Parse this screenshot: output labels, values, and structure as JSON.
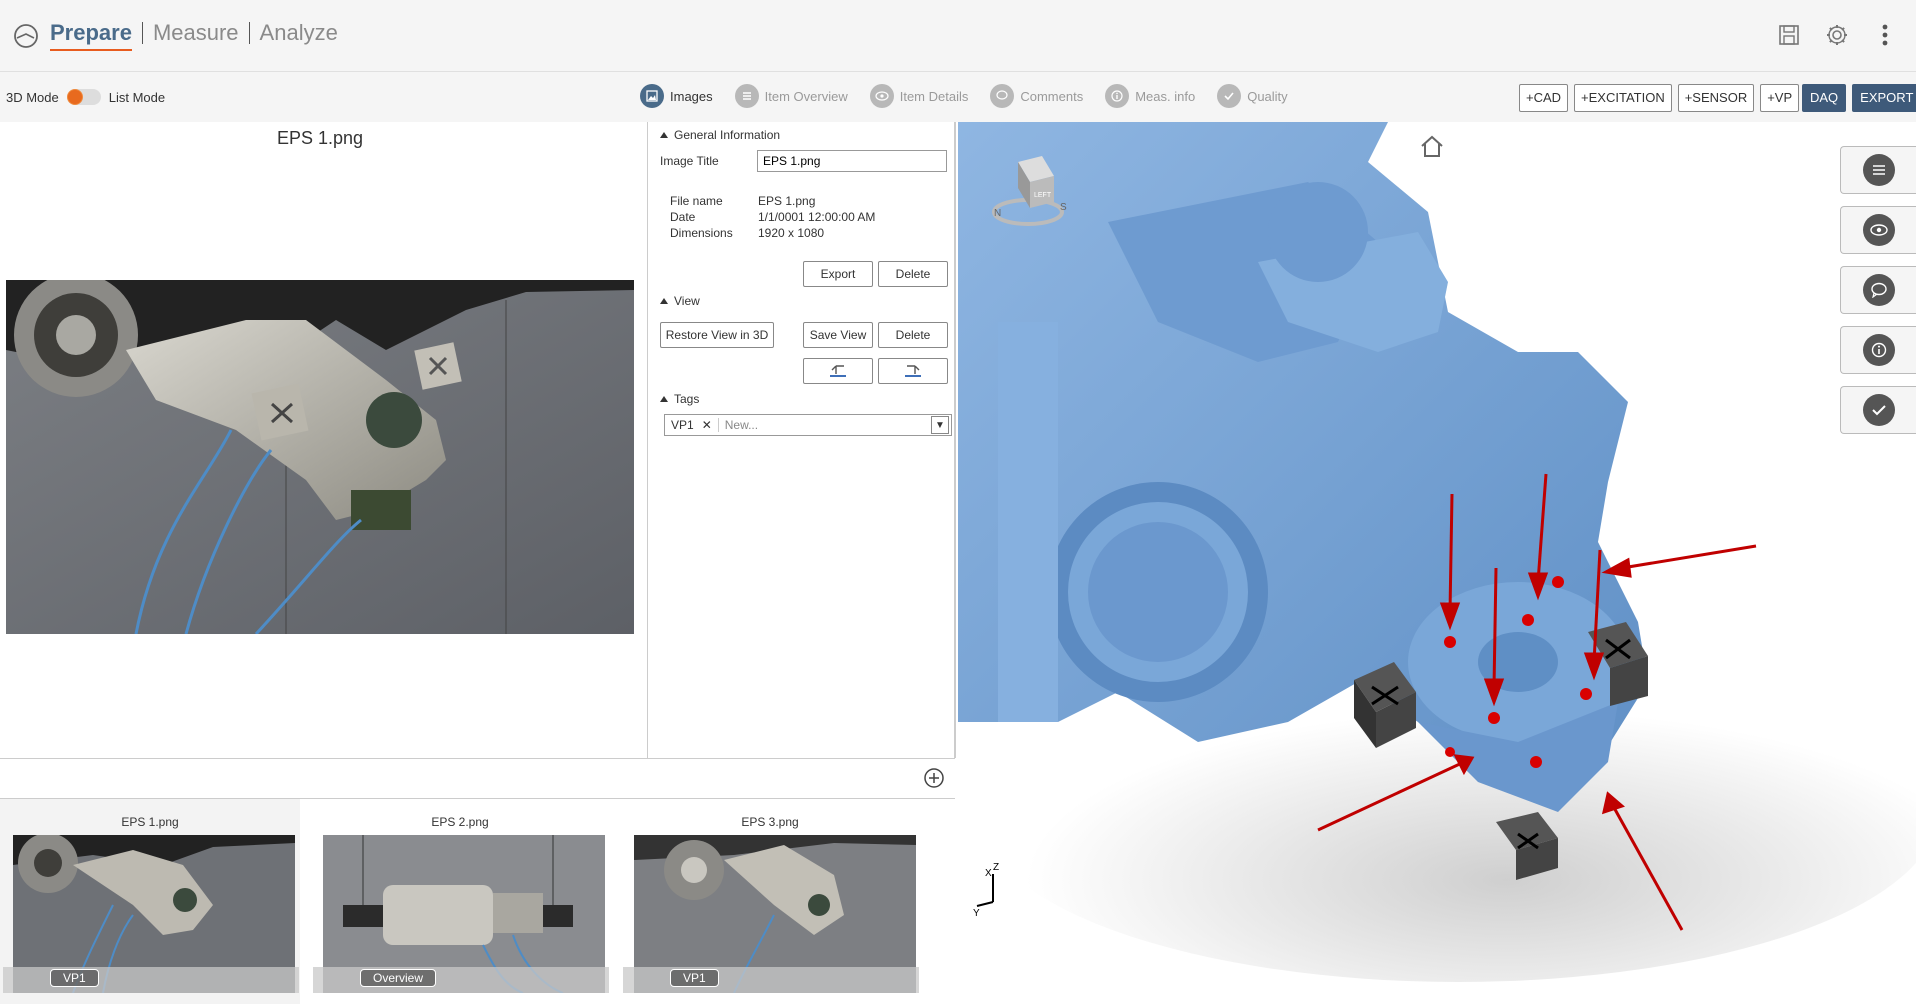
{
  "header": {
    "tabs": [
      {
        "label": "Prepare",
        "active": true
      },
      {
        "label": "Measure",
        "active": false
      },
      {
        "label": "Analyze",
        "active": false
      }
    ],
    "icons": [
      "save-icon",
      "gear-icon",
      "more-vertical-icon"
    ]
  },
  "toolbar": {
    "mode_left": "3D Mode",
    "mode_right": "List Mode",
    "pills": [
      {
        "label": "Images",
        "icon": "image-icon",
        "active": true
      },
      {
        "label": "Item Overview",
        "icon": "list-icon",
        "active": false
      },
      {
        "label": "Item Details",
        "icon": "eye-icon",
        "active": false
      },
      {
        "label": "Comments",
        "icon": "comment-icon",
        "active": false
      },
      {
        "label": "Meas. info",
        "icon": "info-icon",
        "active": false
      },
      {
        "label": "Quality",
        "icon": "check-icon",
        "active": false
      }
    ],
    "add_buttons": [
      "+CAD",
      "+EXCITATION",
      "+SENSOR",
      "+VP"
    ],
    "daq": "DAQ",
    "export": "EXPORT",
    "accent": "#e85c1e",
    "primary": "#3e5a7a"
  },
  "image_view": {
    "title": "EPS 1.png"
  },
  "details": {
    "general_header": "General Information",
    "image_title_label": "Image Title",
    "image_title_value": "EPS 1.png",
    "file_name_label": "File name",
    "file_name": "EPS 1.png",
    "date_label": "Date",
    "date": "1/1/0001 12:00:00 AM",
    "dimensions_label": "Dimensions",
    "dimensions": "1920 x 1080",
    "export_btn": "Export",
    "delete_btn": "Delete",
    "view_header": "View",
    "restore_btn": "Restore View in 3D",
    "save_view_btn": "Save View",
    "delete_view_btn": "Delete",
    "tags_header": "Tags",
    "tag": "VP1",
    "tag_placeholder": "New..."
  },
  "thumbnails": [
    {
      "name": "EPS 1.png",
      "label": "VP1",
      "selected": true
    },
    {
      "name": "EPS 2.png",
      "label": "Overview",
      "selected": false
    },
    {
      "name": "EPS 3.png",
      "label": "VP1",
      "selected": false
    }
  ],
  "view3d": {
    "side_buttons": [
      "menu-icon",
      "eye-icon",
      "comment-icon",
      "info-icon",
      "check-icon"
    ],
    "nav_cube_face": "LEFT",
    "part_color": "#7aa7d8"
  }
}
